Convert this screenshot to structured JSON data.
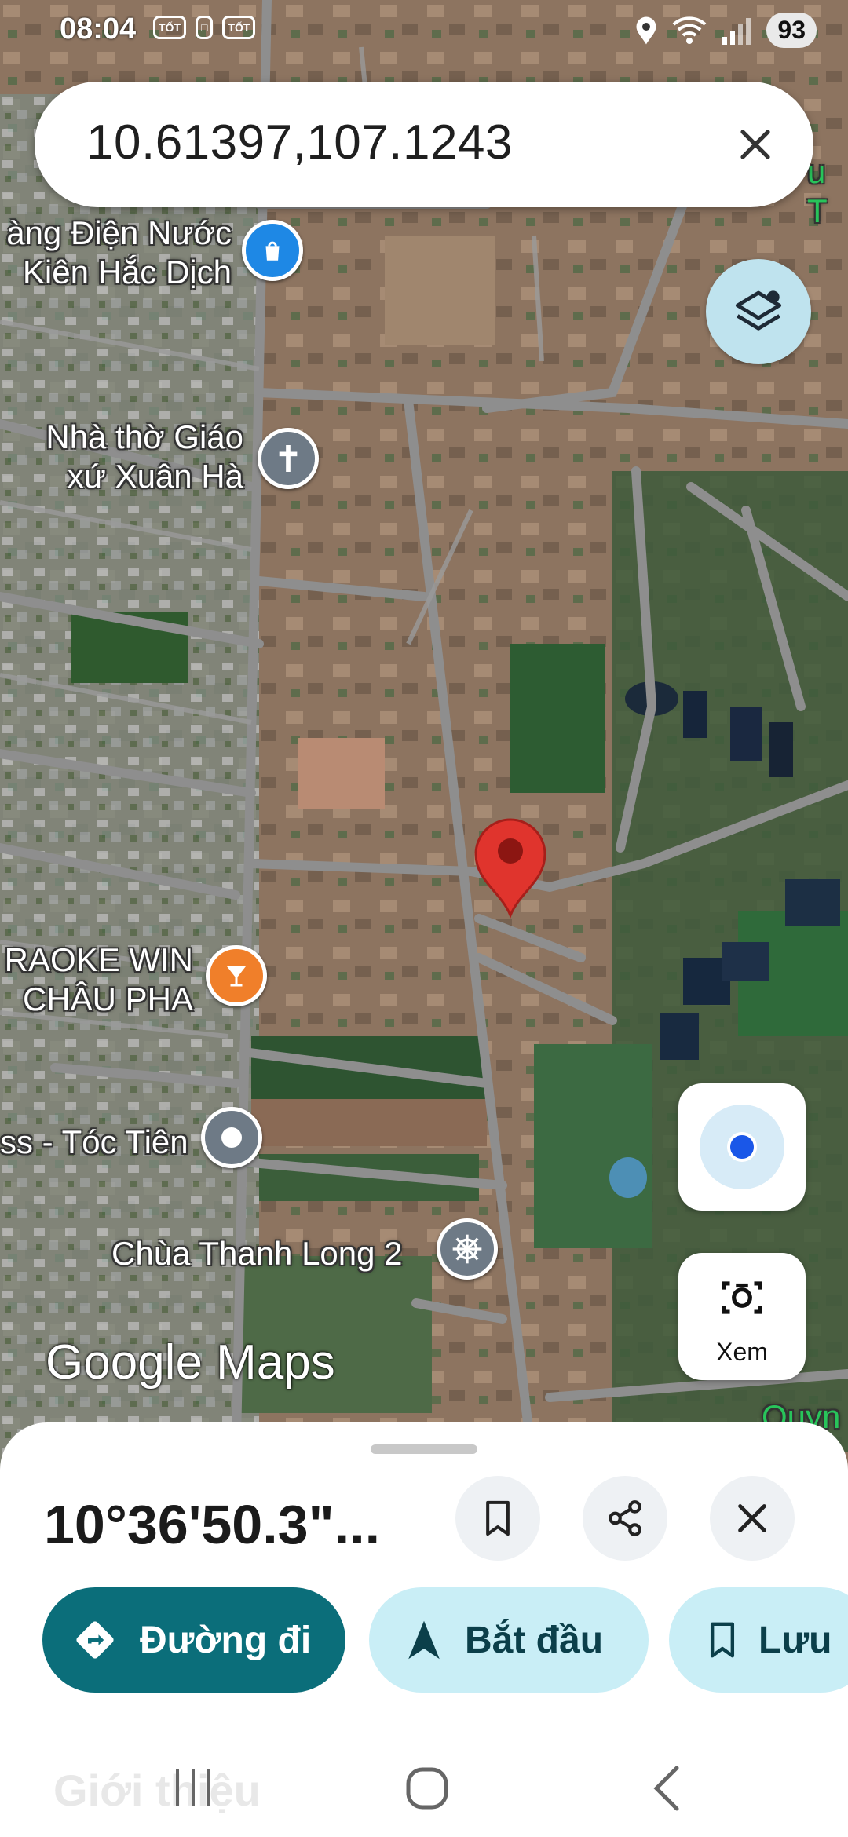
{
  "status": {
    "time": "08:04",
    "small_icons": [
      "TỐT",
      "□",
      "TỐT"
    ],
    "battery": "93"
  },
  "search": {
    "query": "10.61397,107.1243",
    "clear_icon": "close-icon"
  },
  "map_labels": {
    "store": "àng Điện Nước\nKiên Hắc Dịch",
    "church": "Nhà thờ Giáo\nxứ Xuân Hà",
    "karaoke": "RAOKE WIN\nCHÂU PHA",
    "place": "ss - Tóc Tiên",
    "temple": "Chùa Thanh Long 2",
    "top_right": "u T",
    "bottom_right": "Quyn"
  },
  "watermark": "Google Maps",
  "buttons": {
    "lens_label": "Xem"
  },
  "sheet": {
    "coordinate": "10°36'50.3\"...",
    "intro": "Giới thiệu",
    "chips": [
      {
        "label": "Đường đi",
        "icon": "directions-icon"
      },
      {
        "label": "Bắt đầu",
        "icon": "navigation-arrow-icon"
      },
      {
        "label": "Lưu",
        "icon": "bookmark-icon"
      }
    ]
  },
  "colors": {
    "teal": "#0b6e7a",
    "chip_light": "#c9eef6",
    "pin_red": "#e0342d",
    "poi_blue": "#1e88e5",
    "poi_orange": "#f07f2a",
    "poi_gray": "#6e7a86"
  }
}
